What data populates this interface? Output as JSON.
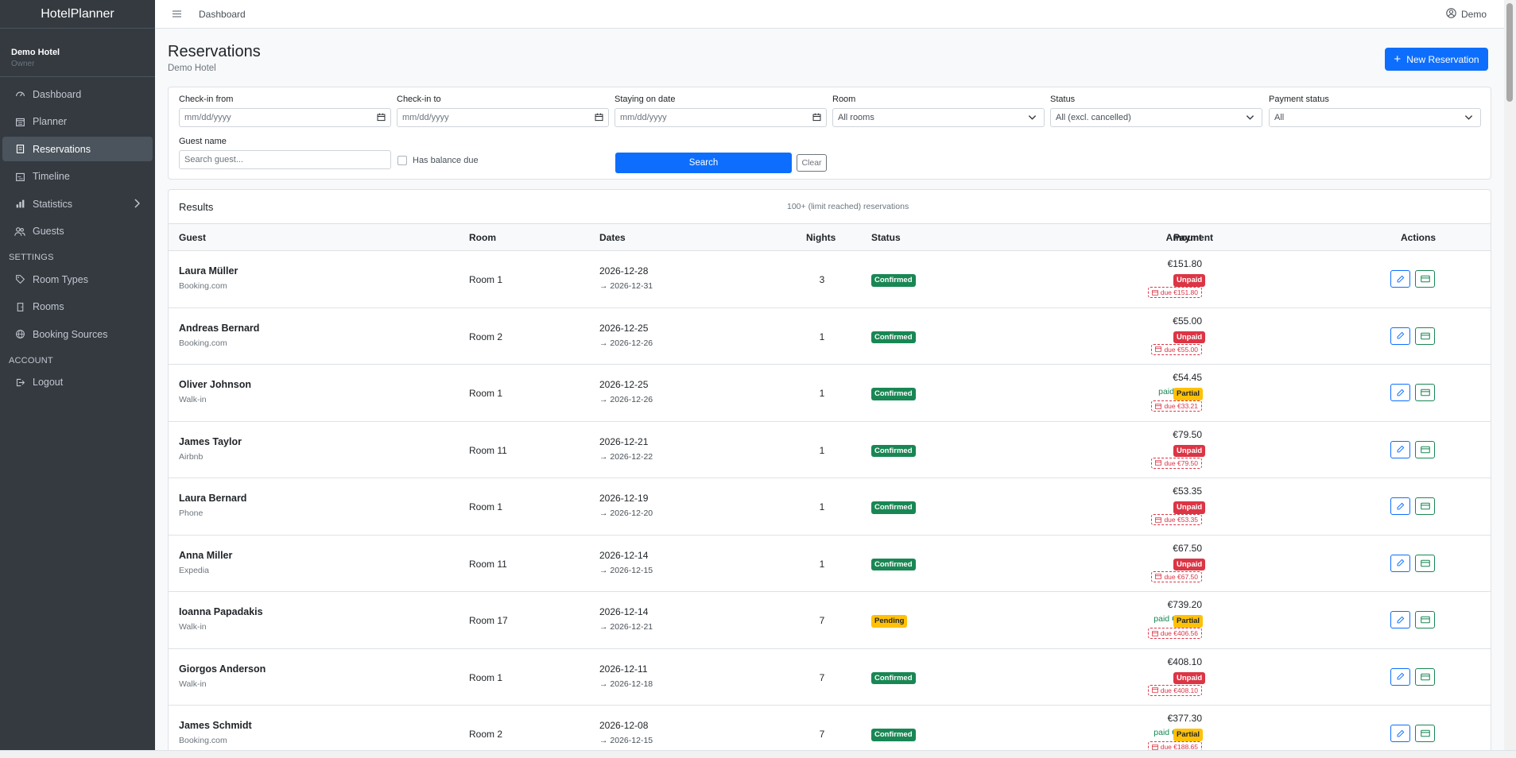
{
  "app": {
    "brand": "HotelPlanner"
  },
  "hotel": {
    "name": "Demo Hotel",
    "role": "Owner"
  },
  "sidebar": {
    "items": [
      {
        "label": "Dashboard",
        "icon": "gauge-icon"
      },
      {
        "label": "Planner",
        "icon": "calendar-grid-icon"
      },
      {
        "label": "Reservations",
        "icon": "journal-icon",
        "active": true
      },
      {
        "label": "Timeline",
        "icon": "timeline-icon"
      },
      {
        "label": "Statistics",
        "icon": "bar-chart-icon"
      },
      {
        "label": "Guests",
        "icon": "people-icon"
      }
    ],
    "settings_heading": "SETTINGS",
    "settings_items": [
      {
        "label": "Room Types",
        "icon": "tag-icon"
      },
      {
        "label": "Rooms",
        "icon": "door-icon"
      },
      {
        "label": "Booking Sources",
        "icon": "globe-icon"
      }
    ],
    "account_heading": "ACCOUNT",
    "account_items": [
      {
        "label": "Logout",
        "icon": "logout-icon"
      }
    ]
  },
  "topbar": {
    "breadcrumb": "Dashboard",
    "user": "Demo"
  },
  "page": {
    "title": "Reservations",
    "subtitle": "Demo Hotel",
    "new_button": "New Reservation"
  },
  "filters": {
    "checkin_from": {
      "label": "Check-in from",
      "placeholder": "mm/dd/yyyy"
    },
    "checkin_to": {
      "label": "Check-in to",
      "placeholder": "mm/dd/yyyy"
    },
    "staying_on": {
      "label": "Staying on date",
      "placeholder": "mm/dd/yyyy"
    },
    "room": {
      "label": "Room",
      "value": "All rooms"
    },
    "status": {
      "label": "Status",
      "value": "All (excl. cancelled)"
    },
    "payment_status": {
      "label": "Payment status",
      "value": "All"
    },
    "guest_name": {
      "label": "Guest name",
      "placeholder": "Search guest..."
    },
    "has_balance_due": "Has balance due",
    "search_button": "Search",
    "clear_button": "Clear"
  },
  "results": {
    "title": "Results",
    "count": "100+ (limit reached) reservations",
    "columns": {
      "guest": "Guest",
      "room": "Room",
      "dates": "Dates",
      "nights": "Nights",
      "status": "Status",
      "amount": "Amount",
      "payment": "Payment",
      "actions": "Actions"
    },
    "rows": [
      {
        "guest": "Laura Müller",
        "source": "Booking.com",
        "room": "Room 1",
        "from": "2026-12-28",
        "to": "→ 2026-12-31",
        "nights": "3",
        "status": "Confirmed",
        "amount": "€151.80",
        "paid": "",
        "due": "due €151.80",
        "payment": "Unpaid"
      },
      {
        "guest": "Andreas Bernard",
        "source": "Booking.com",
        "room": "Room 2",
        "from": "2026-12-25",
        "to": "→ 2026-12-26",
        "nights": "1",
        "status": "Confirmed",
        "amount": "€55.00",
        "paid": "",
        "due": "due €55.00",
        "payment": "Unpaid"
      },
      {
        "guest": "Oliver Johnson",
        "source": "Walk-in",
        "room": "Room 1",
        "from": "2026-12-25",
        "to": "→ 2026-12-26",
        "nights": "1",
        "status": "Confirmed",
        "amount": "€54.45",
        "paid": "paid €21.24",
        "due": "due €33.21",
        "payment": "Partial"
      },
      {
        "guest": "James Taylor",
        "source": "Airbnb",
        "room": "Room 11",
        "from": "2026-12-21",
        "to": "→ 2026-12-22",
        "nights": "1",
        "status": "Confirmed",
        "amount": "€79.50",
        "paid": "",
        "due": "due €79.50",
        "payment": "Unpaid"
      },
      {
        "guest": "Laura Bernard",
        "source": "Phone",
        "room": "Room 1",
        "from": "2026-12-19",
        "to": "→ 2026-12-20",
        "nights": "1",
        "status": "Confirmed",
        "amount": "€53.35",
        "paid": "",
        "due": "due €53.35",
        "payment": "Unpaid"
      },
      {
        "guest": "Anna Miller",
        "source": "Expedia",
        "room": "Room 11",
        "from": "2026-12-14",
        "to": "→ 2026-12-15",
        "nights": "1",
        "status": "Confirmed",
        "amount": "€67.50",
        "paid": "",
        "due": "due €67.50",
        "payment": "Unpaid"
      },
      {
        "guest": "Ioanna Papadakis",
        "source": "Walk-in",
        "room": "Room 17",
        "from": "2026-12-14",
        "to": "→ 2026-12-21",
        "nights": "7",
        "status": "Pending",
        "amount": "€739.20",
        "paid": "paid €332.64",
        "due": "due €406.56",
        "payment": "Partial"
      },
      {
        "guest": "Giorgos Anderson",
        "source": "Walk-in",
        "room": "Room 1",
        "from": "2026-12-11",
        "to": "→ 2026-12-18",
        "nights": "7",
        "status": "Confirmed",
        "amount": "€408.10",
        "paid": "",
        "due": "due €408.10",
        "payment": "Unpaid"
      },
      {
        "guest": "James Schmidt",
        "source": "Booking.com",
        "room": "Room 2",
        "from": "2026-12-08",
        "to": "→ 2026-12-15",
        "nights": "7",
        "status": "Confirmed",
        "amount": "€377.30",
        "paid": "paid €188.65",
        "due": "due €188.65",
        "payment": "Partial"
      }
    ]
  },
  "colors": {
    "primary": "#0d6efd",
    "success": "#198754",
    "warning": "#ffc107",
    "danger": "#dc3545",
    "sidebar": "#343a40"
  }
}
